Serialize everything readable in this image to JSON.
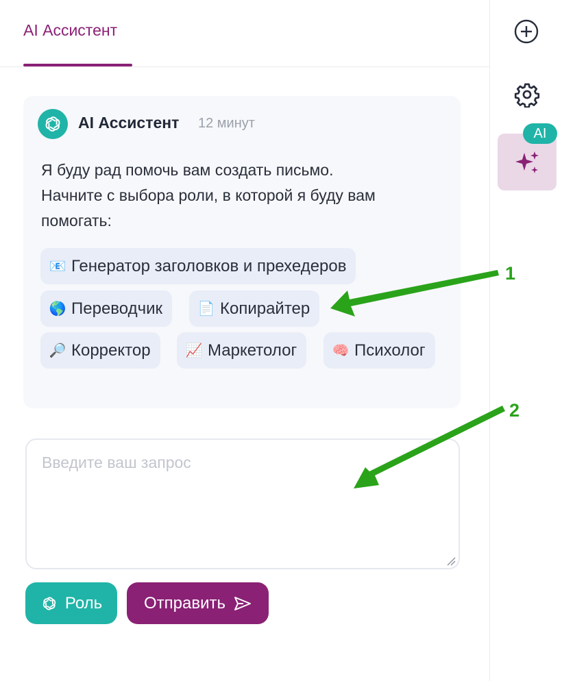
{
  "tabs": [
    {
      "label": "AI Ассистент",
      "active": true
    }
  ],
  "message": {
    "sender": "AI Ассистент",
    "time": "12 минут",
    "text_lines": [
      "Я буду рад помочь вам создать письмо.",
      "Начните с выбора роли, в которой я буду вам",
      "помогать:"
    ],
    "roles": [
      {
        "icon": "📧",
        "label": "Генератор заголовков и прехедеров"
      },
      {
        "icon": "🌎",
        "label": "Переводчик"
      },
      {
        "icon": "📄",
        "label": "Копирайтер"
      },
      {
        "icon": "🔎",
        "label": "Корректор"
      },
      {
        "icon": "📈",
        "label": "Маркетолог"
      },
      {
        "icon": "🧠",
        "label": "Психолог"
      }
    ]
  },
  "input": {
    "placeholder": "Введите ваш запрос",
    "value": ""
  },
  "buttons": {
    "role_label": "Роль",
    "send_label": "Отправить"
  },
  "rail": {
    "ai_badge": "AI",
    "icons": [
      "plus-circle-icon",
      "gear-icon",
      "sparkles-icon"
    ]
  },
  "annotations": [
    {
      "number": "1"
    },
    {
      "number": "2"
    }
  ],
  "colors": {
    "brand": "#8a2175",
    "teal": "#20b4a8",
    "arrow": "#2aa31a"
  }
}
